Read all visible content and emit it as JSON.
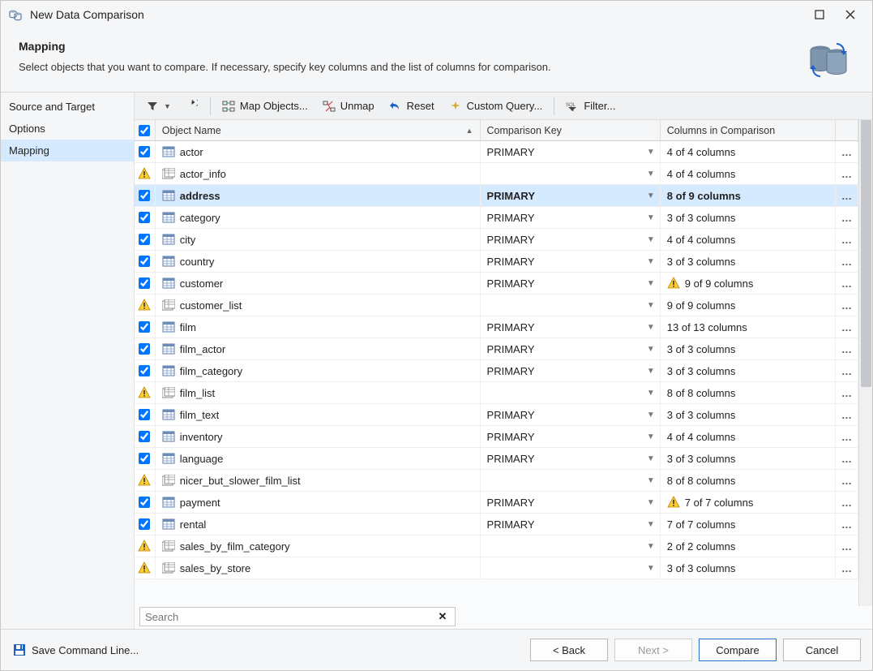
{
  "window": {
    "title": "New Data Comparison"
  },
  "header": {
    "title": "Mapping",
    "subtitle": "Select objects that you want to compare. If necessary, specify key columns and the list of columns for comparison."
  },
  "sidebar": {
    "items": [
      {
        "label": "Source and Target",
        "selected": false
      },
      {
        "label": "Options",
        "selected": false
      },
      {
        "label": "Mapping",
        "selected": true
      }
    ]
  },
  "toolbar": {
    "map_objects": "Map Objects...",
    "unmap": "Unmap",
    "reset": "Reset",
    "custom_query": "Custom Query...",
    "filter": "Filter..."
  },
  "columns": {
    "name": "Object Name",
    "key": "Comparison Key",
    "cols": "Columns in Comparison"
  },
  "rows": [
    {
      "checked": true,
      "chkWarn": false,
      "type": "table",
      "name": "actor",
      "key": "PRIMARY",
      "cols": "4 of 4 columns",
      "colsWarn": false,
      "selected": false
    },
    {
      "checked": false,
      "chkWarn": true,
      "type": "view",
      "name": "actor_info",
      "key": "",
      "cols": "4 of 4 columns",
      "colsWarn": false,
      "selected": false
    },
    {
      "checked": true,
      "chkWarn": false,
      "type": "table",
      "name": "address",
      "key": "PRIMARY",
      "cols": "8 of 9 columns",
      "colsWarn": false,
      "selected": true
    },
    {
      "checked": true,
      "chkWarn": false,
      "type": "table",
      "name": "category",
      "key": "PRIMARY",
      "cols": "3 of 3 columns",
      "colsWarn": false,
      "selected": false
    },
    {
      "checked": true,
      "chkWarn": false,
      "type": "table",
      "name": "city",
      "key": "PRIMARY",
      "cols": "4 of 4 columns",
      "colsWarn": false,
      "selected": false
    },
    {
      "checked": true,
      "chkWarn": false,
      "type": "table",
      "name": "country",
      "key": "PRIMARY",
      "cols": "3 of 3 columns",
      "colsWarn": false,
      "selected": false
    },
    {
      "checked": true,
      "chkWarn": false,
      "type": "table",
      "name": "customer",
      "key": "PRIMARY",
      "cols": "9 of 9 columns",
      "colsWarn": true,
      "selected": false
    },
    {
      "checked": false,
      "chkWarn": true,
      "type": "view",
      "name": "customer_list",
      "key": "",
      "cols": "9 of 9 columns",
      "colsWarn": false,
      "selected": false
    },
    {
      "checked": true,
      "chkWarn": false,
      "type": "table",
      "name": "film",
      "key": "PRIMARY",
      "cols": "13 of 13 columns",
      "colsWarn": false,
      "selected": false
    },
    {
      "checked": true,
      "chkWarn": false,
      "type": "table",
      "name": "film_actor",
      "key": "PRIMARY",
      "cols": "3 of 3 columns",
      "colsWarn": false,
      "selected": false
    },
    {
      "checked": true,
      "chkWarn": false,
      "type": "table",
      "name": "film_category",
      "key": "PRIMARY",
      "cols": "3 of 3 columns",
      "colsWarn": false,
      "selected": false
    },
    {
      "checked": false,
      "chkWarn": true,
      "type": "view",
      "name": "film_list",
      "key": "",
      "cols": "8 of 8 columns",
      "colsWarn": false,
      "selected": false
    },
    {
      "checked": true,
      "chkWarn": false,
      "type": "table",
      "name": "film_text",
      "key": "PRIMARY",
      "cols": "3 of 3 columns",
      "colsWarn": false,
      "selected": false
    },
    {
      "checked": true,
      "chkWarn": false,
      "type": "table",
      "name": "inventory",
      "key": "PRIMARY",
      "cols": "4 of 4 columns",
      "colsWarn": false,
      "selected": false
    },
    {
      "checked": true,
      "chkWarn": false,
      "type": "table",
      "name": "language",
      "key": "PRIMARY",
      "cols": "3 of 3 columns",
      "colsWarn": false,
      "selected": false
    },
    {
      "checked": false,
      "chkWarn": true,
      "type": "view",
      "name": "nicer_but_slower_film_list",
      "key": "",
      "cols": "8 of 8 columns",
      "colsWarn": false,
      "selected": false
    },
    {
      "checked": true,
      "chkWarn": false,
      "type": "table",
      "name": "payment",
      "key": "PRIMARY",
      "cols": "7 of 7 columns",
      "colsWarn": true,
      "selected": false
    },
    {
      "checked": true,
      "chkWarn": false,
      "type": "table",
      "name": "rental",
      "key": "PRIMARY",
      "cols": "7 of 7 columns",
      "colsWarn": false,
      "selected": false
    },
    {
      "checked": false,
      "chkWarn": true,
      "type": "view",
      "name": "sales_by_film_category",
      "key": "",
      "cols": "2 of 2 columns",
      "colsWarn": false,
      "selected": false
    },
    {
      "checked": false,
      "chkWarn": true,
      "type": "view",
      "name": "sales_by_store",
      "key": "",
      "cols": "3 of 3 columns",
      "colsWarn": false,
      "selected": false
    }
  ],
  "search": {
    "placeholder": "Search"
  },
  "footer": {
    "save_cmd": "Save Command Line...",
    "back": "< Back",
    "next": "Next >",
    "compare": "Compare",
    "cancel": "Cancel"
  }
}
